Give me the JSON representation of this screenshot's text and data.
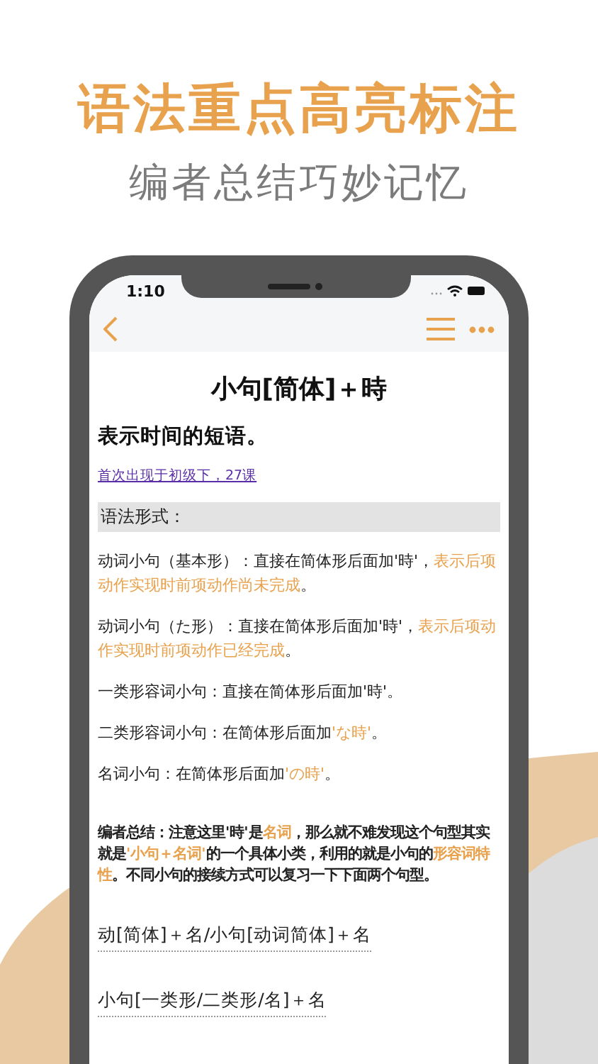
{
  "headline": "语法重点高亮标注",
  "subheadline": "编者总结巧妙记忆",
  "status_bar": {
    "time": "1:10"
  },
  "article": {
    "title": "小句[简体]＋時",
    "meaning": "表示时间的短语。",
    "source_link": "首次出现于初级下，27课",
    "section_header": "语法形式：",
    "paragraphs": [
      [
        {
          "text": "动词小句（基本形）：直接在简体形后面加'時'，",
          "highlight": false
        },
        {
          "text": "表示后项动作实现时前项动作尚未完成",
          "highlight": true
        },
        {
          "text": "。",
          "highlight": false
        }
      ],
      [
        {
          "text": "动词小句（た形）：直接在简体形后面加'時'，",
          "highlight": false
        },
        {
          "text": "表示后项动作实现时前项动作已经完成",
          "highlight": true
        },
        {
          "text": "。",
          "highlight": false
        }
      ],
      [
        {
          "text": "一类形容词小句：直接在简体形后面加'時'。",
          "highlight": false
        }
      ],
      [
        {
          "text": "二类形容词小句：在简体形后面加",
          "highlight": false
        },
        {
          "text": "'な時'",
          "highlight": true
        },
        {
          "text": "。",
          "highlight": false
        }
      ],
      [
        {
          "text": "名词小句：在简体形后面加",
          "highlight": false
        },
        {
          "text": "'の時'",
          "highlight": true
        },
        {
          "text": "。",
          "highlight": false
        }
      ]
    ],
    "summary": [
      {
        "text": "编者总结：注意这里'時'是",
        "highlight": false
      },
      {
        "text": "名词",
        "highlight": true
      },
      {
        "text": "，那么就不难发现这个句型其实就是",
        "highlight": false
      },
      {
        "text": "'小句＋名词'",
        "highlight": true
      },
      {
        "text": "的一个具体小类，利用的就是小句的",
        "highlight": false
      },
      {
        "text": "形容词特性",
        "highlight": true
      },
      {
        "text": "。不同小句的接续方式可以复习一下下面两个句型。",
        "highlight": false
      }
    ],
    "patterns": [
      "动[简体]＋名/小句[动词简体]＋名",
      "小句[一类形/二类形/名]＋名"
    ]
  }
}
